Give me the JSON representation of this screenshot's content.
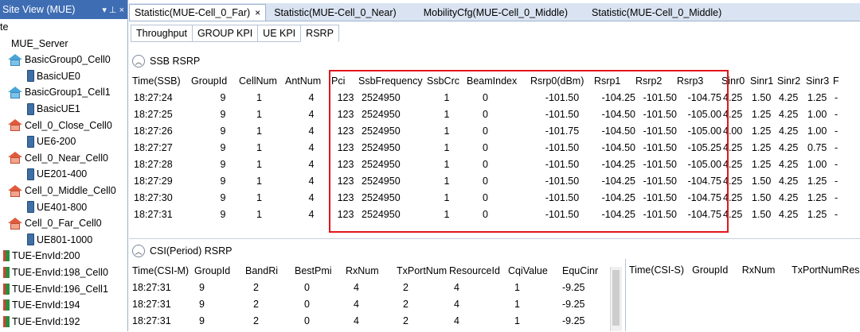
{
  "site_view": {
    "title": "Site View (MUE)",
    "pin_label": "▾ ⊥ ×",
    "tree": [
      {
        "label": "te",
        "indent": 0,
        "icon": "none"
      },
      {
        "label": "MUE_Server",
        "indent": 14,
        "icon": "none"
      },
      {
        "label": "BasicGroup0_Cell0",
        "indent": 10,
        "icon": "house-blue"
      },
      {
        "label": "BasicUE0",
        "indent": 34,
        "icon": "phone"
      },
      {
        "label": "BasicGroup1_Cell1",
        "indent": 10,
        "icon": "house-blue"
      },
      {
        "label": "BasicUE1",
        "indent": 34,
        "icon": "phone"
      },
      {
        "label": "Cell_0_Close_Cell0",
        "indent": 10,
        "icon": "house-red"
      },
      {
        "label": "UE6-200",
        "indent": 34,
        "icon": "phone"
      },
      {
        "label": "Cell_0_Near_Cell0",
        "indent": 10,
        "icon": "house-red"
      },
      {
        "label": "UE201-400",
        "indent": 34,
        "icon": "phone"
      },
      {
        "label": "Cell_0_Middle_Cell0",
        "indent": 10,
        "icon": "house-red"
      },
      {
        "label": "UE401-800",
        "indent": 34,
        "icon": "phone"
      },
      {
        "label": "Cell_0_Far_Cell0",
        "indent": 10,
        "icon": "house-red"
      },
      {
        "label": "UE801-1000",
        "indent": 34,
        "icon": "phone"
      },
      {
        "label": "TUE-EnvId:200",
        "indent": 4,
        "icon": "tue"
      },
      {
        "label": "TUE-EnvId:198_Cell0",
        "indent": 4,
        "icon": "tue"
      },
      {
        "label": "TUE-EnvId:196_Cell1",
        "indent": 4,
        "icon": "tue"
      },
      {
        "label": "TUE-EnvId:194",
        "indent": 4,
        "icon": "tue"
      },
      {
        "label": "TUE-EnvId:192",
        "indent": 4,
        "icon": "tue"
      }
    ]
  },
  "doc_tabs": [
    {
      "label": "Statistic(MUE-Cell_0_Far)",
      "active": true
    },
    {
      "label": "Statistic(MUE-Cell_0_Near)",
      "active": false
    },
    {
      "label": "MobilityCfg(MUE-Cell_0_Middle)",
      "active": false
    },
    {
      "label": "Statistic(MUE-Cell_0_Middle)",
      "active": false
    }
  ],
  "close_glyph": "×",
  "sub_tabs": [
    {
      "label": "Throughput",
      "active": false
    },
    {
      "label": "GROUP KPI",
      "active": false
    },
    {
      "label": "UE KPI",
      "active": false
    },
    {
      "label": "RSRP",
      "active": true
    }
  ],
  "collapse_glyph": "︿",
  "ssb": {
    "title": "SSB RSRP",
    "columns": [
      "Time(SSB)",
      "GroupId",
      "CellNum",
      "AntNum",
      "Pci",
      "SsbFrequency",
      "SsbCrc",
      "BeamIndex",
      "Rsrp0(dBm)",
      "Rsrp1",
      "Rsrp2",
      "Rsrp3",
      "Sinr0",
      "Sinr1",
      "Sinr2",
      "Sinr3",
      "F"
    ],
    "rows": [
      [
        "18:27:24",
        "9",
        "1",
        "4",
        "123",
        "2524950",
        "1",
        "0",
        "-101.50",
        "-104.25",
        "-101.50",
        "-104.75",
        "4.25",
        "1.50",
        "4.25",
        "1.25",
        "-"
      ],
      [
        "18:27:25",
        "9",
        "1",
        "4",
        "123",
        "2524950",
        "1",
        "0",
        "-101.50",
        "-104.50",
        "-101.50",
        "-105.00",
        "4.25",
        "1.25",
        "4.25",
        "1.00",
        "-"
      ],
      [
        "18:27:26",
        "9",
        "1",
        "4",
        "123",
        "2524950",
        "1",
        "0",
        "-101.75",
        "-104.50",
        "-101.50",
        "-105.00",
        "4.00",
        "1.25",
        "4.25",
        "1.00",
        "-"
      ],
      [
        "18:27:27",
        "9",
        "1",
        "4",
        "123",
        "2524950",
        "1",
        "0",
        "-101.50",
        "-104.50",
        "-101.50",
        "-105.25",
        "4.25",
        "1.25",
        "4.25",
        "0.75",
        "-"
      ],
      [
        "18:27:28",
        "9",
        "1",
        "4",
        "123",
        "2524950",
        "1",
        "0",
        "-101.50",
        "-104.25",
        "-101.50",
        "-105.00",
        "4.25",
        "1.25",
        "4.25",
        "1.00",
        "-"
      ],
      [
        "18:27:29",
        "9",
        "1",
        "4",
        "123",
        "2524950",
        "1",
        "0",
        "-101.50",
        "-104.25",
        "-101.50",
        "-104.75",
        "4.25",
        "1.50",
        "4.25",
        "1.25",
        "-"
      ],
      [
        "18:27:30",
        "9",
        "1",
        "4",
        "123",
        "2524950",
        "1",
        "0",
        "-101.50",
        "-104.25",
        "-101.50",
        "-104.75",
        "4.25",
        "1.50",
        "4.25",
        "1.25",
        "-"
      ],
      [
        "18:27:31",
        "9",
        "1",
        "4",
        "123",
        "2524950",
        "1",
        "0",
        "-101.50",
        "-104.25",
        "-101.50",
        "-104.75",
        "4.25",
        "1.50",
        "4.25",
        "1.25",
        "-"
      ]
    ]
  },
  "csi": {
    "title": "CSI(Period) RSRP",
    "columns": [
      "Time(CSI-M)",
      "GroupId",
      "BandRi",
      "BestPmi",
      "RxNum",
      "TxPortNum",
      "ResourceId",
      "CqiValue",
      "EquCinr"
    ],
    "rows": [
      [
        "18:27:31",
        "9",
        "2",
        "0",
        "4",
        "2",
        "4",
        "1",
        "-9.25"
      ],
      [
        "18:27:31",
        "9",
        "2",
        "0",
        "4",
        "2",
        "4",
        "1",
        "-9.25"
      ],
      [
        "18:27:31",
        "9",
        "2",
        "0",
        "4",
        "2",
        "4",
        "1",
        "-9.25"
      ]
    ],
    "s_columns": [
      "Time(CSI-S)",
      "GroupId",
      "RxNum",
      "TxPortNumRes"
    ]
  },
  "colors": {
    "highlight": "#e0161c",
    "title_bar": "#3e6db4"
  }
}
